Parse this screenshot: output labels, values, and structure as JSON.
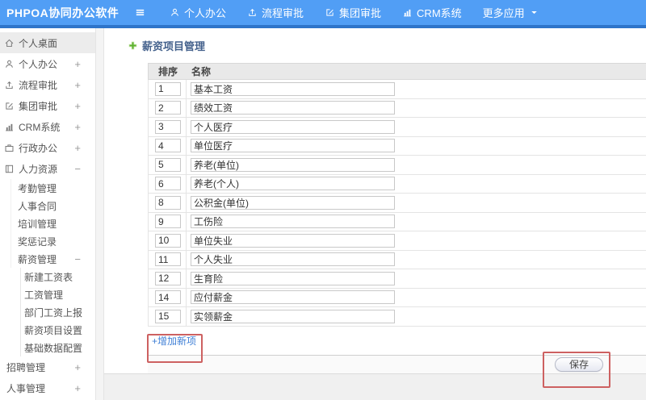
{
  "colors": {
    "topbar_blue": "#519ef5",
    "topbar_edge": "#2e74c9",
    "annotation_red": "#cd6161",
    "link_blue": "#3f7fd6",
    "title_color": "#44618c",
    "plus_green": "#5eb232"
  },
  "topbar": {
    "logo": "PHPOA协同办公软件",
    "nav": [
      {
        "label": "个人办公",
        "icon": "person-icon"
      },
      {
        "label": "流程审批",
        "icon": "flow-icon"
      },
      {
        "label": "集团审批",
        "icon": "compose-icon"
      },
      {
        "label": "CRM系统",
        "icon": "chart-icon"
      },
      {
        "label": "更多应用",
        "icon": "caret-down-icon",
        "icon_position": "after"
      }
    ]
  },
  "sidebar": {
    "items": [
      {
        "label": "个人桌面",
        "icon": "home-icon",
        "level": 1,
        "active": true
      },
      {
        "label": "个人办公",
        "icon": "user-icon",
        "level": 1,
        "expand": "+"
      },
      {
        "label": "流程审批",
        "icon": "flow-icon",
        "level": 1,
        "expand": "+"
      },
      {
        "label": "集团审批",
        "icon": "compose-icon",
        "level": 1,
        "expand": "+"
      },
      {
        "label": "CRM系统",
        "icon": "chart-icon",
        "level": 1,
        "expand": "+"
      },
      {
        "label": "行政办公",
        "icon": "briefcase-icon",
        "level": 1,
        "expand": "+"
      },
      {
        "label": "人力资源",
        "icon": "hr-icon",
        "level": 1,
        "expand": "−"
      },
      {
        "label": "考勤管理",
        "level": 2
      },
      {
        "label": "人事合同",
        "level": 2
      },
      {
        "label": "培训管理",
        "level": 2
      },
      {
        "label": "奖惩记录",
        "level": 2
      },
      {
        "label": "薪资管理",
        "level": 2,
        "expand": "−"
      },
      {
        "label": "新建工资表",
        "level": 3
      },
      {
        "label": "工资管理",
        "level": 3
      },
      {
        "label": "部门工资上报",
        "level": 3
      },
      {
        "label": "薪资项目设置",
        "level": 3
      },
      {
        "label": "基础数据配置",
        "level": 3
      },
      {
        "label": "招聘管理",
        "level": 0,
        "expand": "+"
      },
      {
        "label": "人事管理",
        "level": 0,
        "expand": "+"
      }
    ]
  },
  "main": {
    "title": "薪资项目管理",
    "table": {
      "headers": [
        "排序",
        "名称"
      ],
      "rows": [
        {
          "order": "1",
          "name": "基本工资"
        },
        {
          "order": "2",
          "name": "绩效工资"
        },
        {
          "order": "3",
          "name": "个人医疗"
        },
        {
          "order": "4",
          "name": "单位医疗"
        },
        {
          "order": "5",
          "name": "养老(单位)"
        },
        {
          "order": "6",
          "name": "养老(个人)"
        },
        {
          "order": "8",
          "name": "公积金(单位)"
        },
        {
          "order": "9",
          "name": "工伤险"
        },
        {
          "order": "10",
          "name": "单位失业"
        },
        {
          "order": "11",
          "name": "个人失业"
        },
        {
          "order": "12",
          "name": "生育险"
        },
        {
          "order": "14",
          "name": "应付薪金"
        },
        {
          "order": "15",
          "name": "实领薪金"
        }
      ]
    },
    "add_link": "+增加新项",
    "save_button": "保存"
  }
}
